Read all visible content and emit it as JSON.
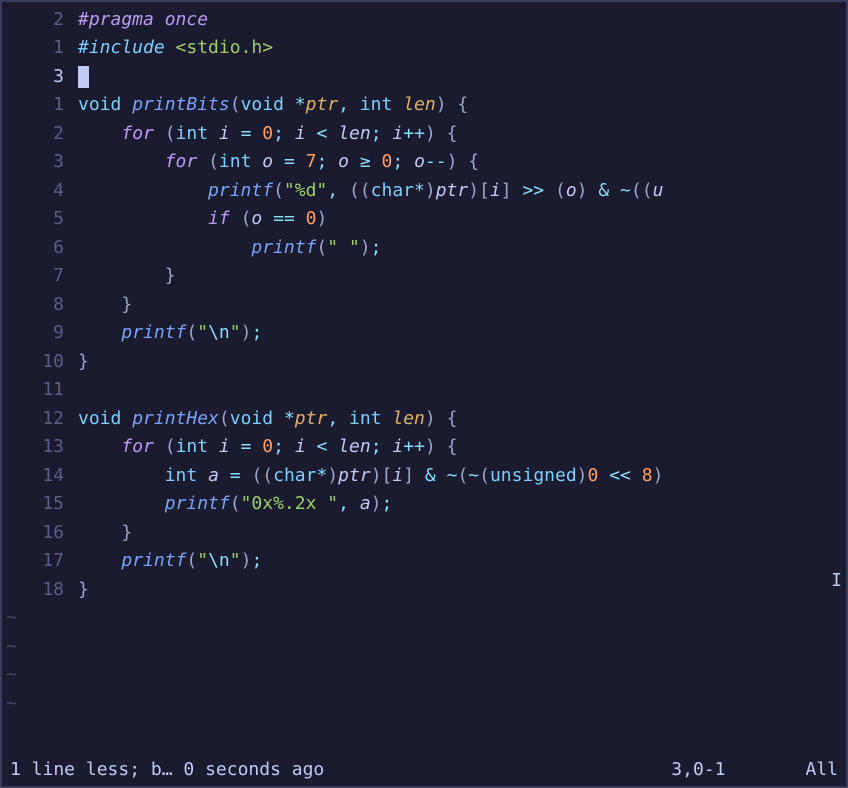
{
  "lines": [
    {
      "num": "2",
      "current": false,
      "tokens": [
        {
          "cls": "preproc",
          "text": "#pragma"
        },
        {
          "cls": "preproc",
          "text": " "
        },
        {
          "cls": "preproc",
          "text": "once"
        }
      ]
    },
    {
      "num": "1",
      "current": false,
      "tokens": [
        {
          "cls": "include",
          "text": "#include "
        },
        {
          "cls": "header",
          "text": "<stdio.h>"
        }
      ]
    },
    {
      "num": "3",
      "current": true,
      "tokens": [
        {
          "cls": "cursor",
          "text": " "
        }
      ]
    },
    {
      "num": "1",
      "current": false,
      "tokens": [
        {
          "cls": "type",
          "text": "void"
        },
        {
          "cls": "",
          "text": " "
        },
        {
          "cls": "func",
          "text": "printBits"
        },
        {
          "cls": "paren",
          "text": "("
        },
        {
          "cls": "type",
          "text": "void"
        },
        {
          "cls": "",
          "text": " "
        },
        {
          "cls": "op",
          "text": "*"
        },
        {
          "cls": "param",
          "text": "ptr"
        },
        {
          "cls": "punct",
          "text": ","
        },
        {
          "cls": "",
          "text": " "
        },
        {
          "cls": "type",
          "text": "int"
        },
        {
          "cls": "",
          "text": " "
        },
        {
          "cls": "param",
          "text": "len"
        },
        {
          "cls": "paren",
          "text": ")"
        },
        {
          "cls": "",
          "text": " "
        },
        {
          "cls": "brace",
          "text": "{"
        }
      ]
    },
    {
      "num": "2",
      "current": false,
      "tokens": [
        {
          "cls": "",
          "text": "    "
        },
        {
          "cls": "kw",
          "text": "for"
        },
        {
          "cls": "",
          "text": " "
        },
        {
          "cls": "paren",
          "text": "("
        },
        {
          "cls": "type",
          "text": "int"
        },
        {
          "cls": "",
          "text": " "
        },
        {
          "cls": "ident",
          "text": "i"
        },
        {
          "cls": "",
          "text": " "
        },
        {
          "cls": "op",
          "text": "="
        },
        {
          "cls": "",
          "text": " "
        },
        {
          "cls": "num",
          "text": "0"
        },
        {
          "cls": "punct",
          "text": ";"
        },
        {
          "cls": "",
          "text": " "
        },
        {
          "cls": "ident",
          "text": "i"
        },
        {
          "cls": "",
          "text": " "
        },
        {
          "cls": "op",
          "text": "<"
        },
        {
          "cls": "",
          "text": " "
        },
        {
          "cls": "ident",
          "text": "len"
        },
        {
          "cls": "punct",
          "text": ";"
        },
        {
          "cls": "",
          "text": " "
        },
        {
          "cls": "ident",
          "text": "i"
        },
        {
          "cls": "op",
          "text": "++"
        },
        {
          "cls": "paren",
          "text": ")"
        },
        {
          "cls": "",
          "text": " "
        },
        {
          "cls": "brace",
          "text": "{"
        }
      ]
    },
    {
      "num": "3",
      "current": false,
      "tokens": [
        {
          "cls": "",
          "text": "        "
        },
        {
          "cls": "kw",
          "text": "for"
        },
        {
          "cls": "",
          "text": " "
        },
        {
          "cls": "paren",
          "text": "("
        },
        {
          "cls": "type",
          "text": "int"
        },
        {
          "cls": "",
          "text": " "
        },
        {
          "cls": "ident",
          "text": "o"
        },
        {
          "cls": "",
          "text": " "
        },
        {
          "cls": "op",
          "text": "="
        },
        {
          "cls": "",
          "text": " "
        },
        {
          "cls": "num",
          "text": "7"
        },
        {
          "cls": "punct",
          "text": ";"
        },
        {
          "cls": "",
          "text": " "
        },
        {
          "cls": "ident",
          "text": "o"
        },
        {
          "cls": "",
          "text": " "
        },
        {
          "cls": "op",
          "text": "≥"
        },
        {
          "cls": "",
          "text": " "
        },
        {
          "cls": "num",
          "text": "0"
        },
        {
          "cls": "punct",
          "text": ";"
        },
        {
          "cls": "",
          "text": " "
        },
        {
          "cls": "ident",
          "text": "o"
        },
        {
          "cls": "op",
          "text": "--"
        },
        {
          "cls": "paren",
          "text": ")"
        },
        {
          "cls": "",
          "text": " "
        },
        {
          "cls": "brace",
          "text": "{"
        }
      ]
    },
    {
      "num": "4",
      "current": false,
      "tokens": [
        {
          "cls": "",
          "text": "            "
        },
        {
          "cls": "func-call",
          "text": "printf"
        },
        {
          "cls": "paren",
          "text": "("
        },
        {
          "cls": "str",
          "text": "\"%d\""
        },
        {
          "cls": "punct",
          "text": ","
        },
        {
          "cls": "",
          "text": " "
        },
        {
          "cls": "paren",
          "text": "(("
        },
        {
          "cls": "type",
          "text": "char"
        },
        {
          "cls": "op",
          "text": "*"
        },
        {
          "cls": "paren",
          "text": ")"
        },
        {
          "cls": "ident",
          "text": "ptr"
        },
        {
          "cls": "paren",
          "text": ")["
        },
        {
          "cls": "ident",
          "text": "i"
        },
        {
          "cls": "paren",
          "text": "]"
        },
        {
          "cls": "",
          "text": " "
        },
        {
          "cls": "op",
          "text": ">>"
        },
        {
          "cls": "",
          "text": " "
        },
        {
          "cls": "paren",
          "text": "("
        },
        {
          "cls": "ident",
          "text": "o"
        },
        {
          "cls": "paren",
          "text": ")"
        },
        {
          "cls": "",
          "text": " "
        },
        {
          "cls": "op",
          "text": "&"
        },
        {
          "cls": "",
          "text": " "
        },
        {
          "cls": "op",
          "text": "~"
        },
        {
          "cls": "paren",
          "text": "(("
        },
        {
          "cls": "ident",
          "text": "u"
        }
      ]
    },
    {
      "num": "5",
      "current": false,
      "tokens": [
        {
          "cls": "",
          "text": "            "
        },
        {
          "cls": "kw",
          "text": "if"
        },
        {
          "cls": "",
          "text": " "
        },
        {
          "cls": "paren",
          "text": "("
        },
        {
          "cls": "ident",
          "text": "o"
        },
        {
          "cls": "",
          "text": " "
        },
        {
          "cls": "op",
          "text": "=="
        },
        {
          "cls": "",
          "text": " "
        },
        {
          "cls": "num",
          "text": "0"
        },
        {
          "cls": "paren",
          "text": ")"
        }
      ]
    },
    {
      "num": "6",
      "current": false,
      "tokens": [
        {
          "cls": "",
          "text": "                "
        },
        {
          "cls": "func-call",
          "text": "printf"
        },
        {
          "cls": "paren",
          "text": "("
        },
        {
          "cls": "str",
          "text": "\" \""
        },
        {
          "cls": "paren",
          "text": ")"
        },
        {
          "cls": "punct",
          "text": ";"
        }
      ]
    },
    {
      "num": "7",
      "current": false,
      "tokens": [
        {
          "cls": "",
          "text": "        "
        },
        {
          "cls": "brace",
          "text": "}"
        }
      ]
    },
    {
      "num": "8",
      "current": false,
      "tokens": [
        {
          "cls": "",
          "text": "    "
        },
        {
          "cls": "brace",
          "text": "}"
        }
      ]
    },
    {
      "num": "9",
      "current": false,
      "tokens": [
        {
          "cls": "",
          "text": "    "
        },
        {
          "cls": "func-call",
          "text": "printf"
        },
        {
          "cls": "paren",
          "text": "("
        },
        {
          "cls": "str",
          "text": "\""
        },
        {
          "cls": "esc",
          "text": "\\n"
        },
        {
          "cls": "str",
          "text": "\""
        },
        {
          "cls": "paren",
          "text": ")"
        },
        {
          "cls": "punct",
          "text": ";"
        }
      ]
    },
    {
      "num": "10",
      "current": false,
      "tokens": [
        {
          "cls": "brace",
          "text": "}"
        }
      ]
    },
    {
      "num": "11",
      "current": false,
      "tokens": []
    },
    {
      "num": "12",
      "current": false,
      "tokens": [
        {
          "cls": "type",
          "text": "void"
        },
        {
          "cls": "",
          "text": " "
        },
        {
          "cls": "func",
          "text": "printHex"
        },
        {
          "cls": "paren",
          "text": "("
        },
        {
          "cls": "type",
          "text": "void"
        },
        {
          "cls": "",
          "text": " "
        },
        {
          "cls": "op",
          "text": "*"
        },
        {
          "cls": "param",
          "text": "ptr"
        },
        {
          "cls": "punct",
          "text": ","
        },
        {
          "cls": "",
          "text": " "
        },
        {
          "cls": "type",
          "text": "int"
        },
        {
          "cls": "",
          "text": " "
        },
        {
          "cls": "param",
          "text": "len"
        },
        {
          "cls": "paren",
          "text": ")"
        },
        {
          "cls": "",
          "text": " "
        },
        {
          "cls": "brace",
          "text": "{"
        }
      ]
    },
    {
      "num": "13",
      "current": false,
      "tokens": [
        {
          "cls": "",
          "text": "    "
        },
        {
          "cls": "kw",
          "text": "for"
        },
        {
          "cls": "",
          "text": " "
        },
        {
          "cls": "paren",
          "text": "("
        },
        {
          "cls": "type",
          "text": "int"
        },
        {
          "cls": "",
          "text": " "
        },
        {
          "cls": "ident",
          "text": "i"
        },
        {
          "cls": "",
          "text": " "
        },
        {
          "cls": "op",
          "text": "="
        },
        {
          "cls": "",
          "text": " "
        },
        {
          "cls": "num",
          "text": "0"
        },
        {
          "cls": "punct",
          "text": ";"
        },
        {
          "cls": "",
          "text": " "
        },
        {
          "cls": "ident",
          "text": "i"
        },
        {
          "cls": "",
          "text": " "
        },
        {
          "cls": "op",
          "text": "<"
        },
        {
          "cls": "",
          "text": " "
        },
        {
          "cls": "ident",
          "text": "len"
        },
        {
          "cls": "punct",
          "text": ";"
        },
        {
          "cls": "",
          "text": " "
        },
        {
          "cls": "ident",
          "text": "i"
        },
        {
          "cls": "op",
          "text": "++"
        },
        {
          "cls": "paren",
          "text": ")"
        },
        {
          "cls": "",
          "text": " "
        },
        {
          "cls": "brace",
          "text": "{"
        }
      ]
    },
    {
      "num": "14",
      "current": false,
      "tokens": [
        {
          "cls": "",
          "text": "        "
        },
        {
          "cls": "type",
          "text": "int"
        },
        {
          "cls": "",
          "text": " "
        },
        {
          "cls": "ident",
          "text": "a"
        },
        {
          "cls": "",
          "text": " "
        },
        {
          "cls": "op",
          "text": "="
        },
        {
          "cls": "",
          "text": " "
        },
        {
          "cls": "paren",
          "text": "(("
        },
        {
          "cls": "type",
          "text": "char"
        },
        {
          "cls": "op",
          "text": "*"
        },
        {
          "cls": "paren",
          "text": ")"
        },
        {
          "cls": "ident",
          "text": "ptr"
        },
        {
          "cls": "paren",
          "text": ")["
        },
        {
          "cls": "ident",
          "text": "i"
        },
        {
          "cls": "paren",
          "text": "]"
        },
        {
          "cls": "",
          "text": " "
        },
        {
          "cls": "op",
          "text": "&"
        },
        {
          "cls": "",
          "text": " "
        },
        {
          "cls": "op",
          "text": "~"
        },
        {
          "cls": "paren",
          "text": "("
        },
        {
          "cls": "op",
          "text": "~"
        },
        {
          "cls": "paren",
          "text": "("
        },
        {
          "cls": "type",
          "text": "unsigned"
        },
        {
          "cls": "paren",
          "text": ")"
        },
        {
          "cls": "num",
          "text": "0"
        },
        {
          "cls": "",
          "text": " "
        },
        {
          "cls": "op",
          "text": "<<"
        },
        {
          "cls": "",
          "text": " "
        },
        {
          "cls": "num",
          "text": "8"
        },
        {
          "cls": "paren",
          "text": ")"
        }
      ]
    },
    {
      "num": "15",
      "current": false,
      "tokens": [
        {
          "cls": "",
          "text": "        "
        },
        {
          "cls": "func-call",
          "text": "printf"
        },
        {
          "cls": "paren",
          "text": "("
        },
        {
          "cls": "str",
          "text": "\"0x%.2x \""
        },
        {
          "cls": "punct",
          "text": ","
        },
        {
          "cls": "",
          "text": " "
        },
        {
          "cls": "ident",
          "text": "a"
        },
        {
          "cls": "paren",
          "text": ")"
        },
        {
          "cls": "punct",
          "text": ";"
        }
      ]
    },
    {
      "num": "16",
      "current": false,
      "tokens": [
        {
          "cls": "",
          "text": "    "
        },
        {
          "cls": "brace",
          "text": "}"
        }
      ]
    },
    {
      "num": "17",
      "current": false,
      "tokens": [
        {
          "cls": "",
          "text": "    "
        },
        {
          "cls": "func-call",
          "text": "printf"
        },
        {
          "cls": "paren",
          "text": "("
        },
        {
          "cls": "str",
          "text": "\""
        },
        {
          "cls": "esc",
          "text": "\\n"
        },
        {
          "cls": "str",
          "text": "\""
        },
        {
          "cls": "paren",
          "text": ")"
        },
        {
          "cls": "punct",
          "text": ";"
        }
      ]
    },
    {
      "num": "18",
      "current": false,
      "tokens": [
        {
          "cls": "brace",
          "text": "}"
        }
      ]
    }
  ],
  "tildes": 4,
  "status": {
    "left": "1 line less; b… 0 seconds ago",
    "pos": "3,0-1",
    "right": "All"
  }
}
